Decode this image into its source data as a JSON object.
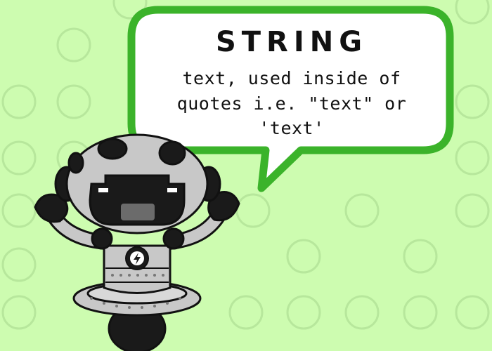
{
  "palette": {
    "background": "#cdfcb0",
    "circle_outline": "#b7e79c",
    "bubble_border": "#3bb32a",
    "bubble_fill": "#ffffff",
    "robot_gray": "#c8c8c8",
    "robot_dark": "#1a1a1a"
  },
  "bubble": {
    "title": "STRING",
    "lines": [
      "text, used inside of",
      "quotes i.e. \"text\" or",
      "'text'"
    ]
  },
  "robot": {
    "chest_icon": "lightning-bolt-icon"
  }
}
